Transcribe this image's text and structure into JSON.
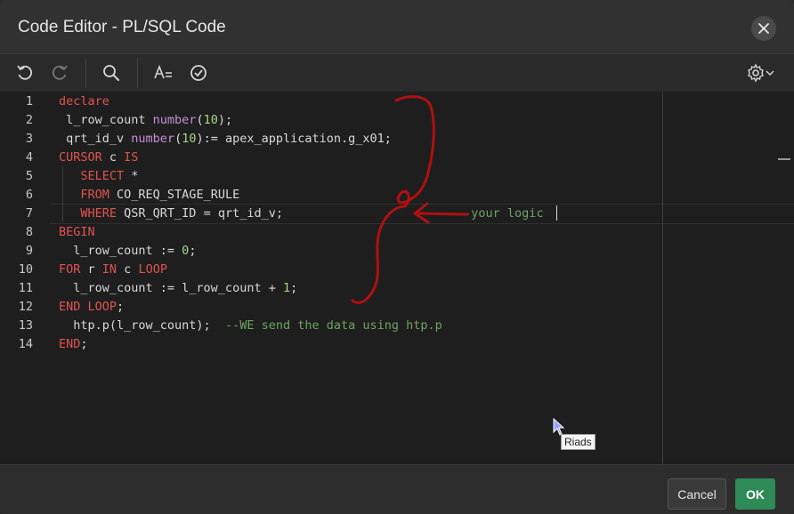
{
  "dialog": {
    "title": "Code Editor - PL/SQL Code"
  },
  "toolbar": {
    "icons": [
      "undo-icon",
      "redo-icon",
      "search-icon",
      "text-format-icon",
      "validate-check-icon",
      "settings-gear-icon"
    ]
  },
  "editor": {
    "line_numbers": [
      "1",
      "2",
      "3",
      "4",
      "5",
      "6",
      "7",
      "8",
      "9",
      "10",
      "11",
      "12",
      "13",
      "14"
    ],
    "lines": [
      [
        {
          "t": "declare",
          "c": "kw"
        }
      ],
      [
        {
          "t": " l_row_count ",
          "c": ""
        },
        {
          "t": "number",
          "c": "ty"
        },
        {
          "t": "(",
          "c": ""
        },
        {
          "t": "10",
          "c": "num"
        },
        {
          "t": ");",
          "c": ""
        }
      ],
      [
        {
          "t": " qrt_id_v ",
          "c": ""
        },
        {
          "t": "number",
          "c": "ty"
        },
        {
          "t": "(",
          "c": ""
        },
        {
          "t": "10",
          "c": "num"
        },
        {
          "t": "):= apex_application.g_x01;",
          "c": ""
        }
      ],
      [
        {
          "t": "CURSOR",
          "c": "kw"
        },
        {
          "t": " c ",
          "c": ""
        },
        {
          "t": "IS",
          "c": "kw"
        }
      ],
      [
        {
          "t": "   ",
          "c": ""
        },
        {
          "t": "SELECT",
          "c": "kw"
        },
        {
          "t": " *",
          "c": ""
        }
      ],
      [
        {
          "t": "   ",
          "c": ""
        },
        {
          "t": "FROM",
          "c": "kw"
        },
        {
          "t": " CO_REQ_STAGE_RULE",
          "c": ""
        }
      ],
      [
        {
          "t": "   ",
          "c": ""
        },
        {
          "t": "WHERE",
          "c": "kw"
        },
        {
          "t": " QSR_QRT_ID = qrt_id_v;",
          "c": ""
        },
        {
          "t": "                        --your logic",
          "c": "cm"
        }
      ],
      [
        {
          "t": "BEGIN",
          "c": "kw"
        }
      ],
      [
        {
          "t": "  l_row_count := ",
          "c": ""
        },
        {
          "t": "0",
          "c": "num"
        },
        {
          "t": ";",
          "c": ""
        }
      ],
      [
        {
          "t": "FOR",
          "c": "kw"
        },
        {
          "t": " r ",
          "c": ""
        },
        {
          "t": "IN",
          "c": "kw"
        },
        {
          "t": " c ",
          "c": ""
        },
        {
          "t": "LOOP",
          "c": "kw"
        }
      ],
      [
        {
          "t": "  l_row_count := l_row_count + ",
          "c": ""
        },
        {
          "t": "1",
          "c": "num"
        },
        {
          "t": ";",
          "c": ""
        }
      ],
      [
        {
          "t": "END",
          "c": "kw"
        },
        {
          "t": " ",
          "c": ""
        },
        {
          "t": "LOOP",
          "c": "kw"
        },
        {
          "t": ";",
          "c": ""
        }
      ],
      [
        {
          "t": "  htp.p(l_row_count);  ",
          "c": ""
        },
        {
          "t": "--WE send the data using htp.p",
          "c": "cm"
        }
      ],
      [
        {
          "t": "END",
          "c": "kw"
        },
        {
          "t": ";",
          "c": ""
        }
      ]
    ]
  },
  "footer": {
    "cancel_label": "Cancel",
    "ok_label": "OK"
  },
  "tooltip": {
    "text": "Riads"
  },
  "colors": {
    "keyword": "#e2534e",
    "type": "#c78fd6",
    "number": "#a6d68b",
    "comment": "#6fa263",
    "ok_button": "#2e8b57",
    "annotation": "#b01010"
  }
}
